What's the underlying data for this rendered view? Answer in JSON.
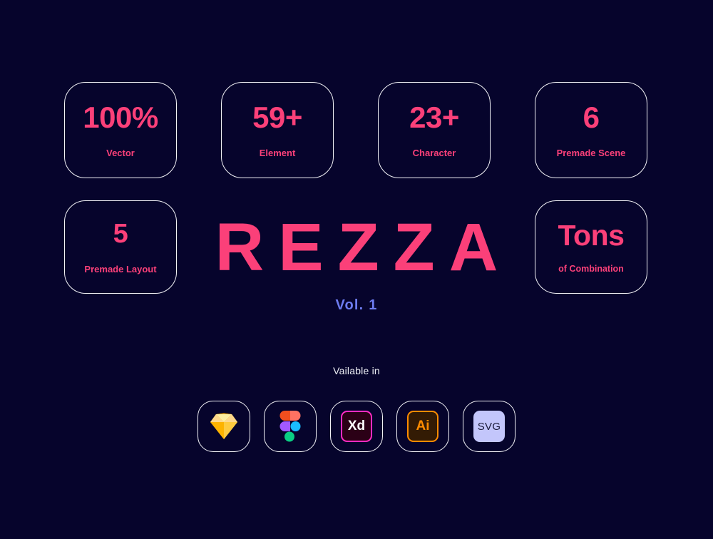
{
  "background_color": "#06042c",
  "accent_pink": "#fb4079",
  "accent_periwinkle": "#6d7cf0",
  "border_color": "#f2f2f7",
  "stats_row_one": [
    {
      "value": "100%",
      "label": "Vector"
    },
    {
      "value": "59+",
      "label": "Element"
    },
    {
      "value": "23+",
      "label": "Character"
    },
    {
      "value": "6",
      "label": "Premade Scene"
    }
  ],
  "stats_row_two": [
    {
      "value": "5",
      "label": "Premade Layout"
    },
    {
      "value": "Tons",
      "label": "of Combination"
    }
  ],
  "brand": {
    "title": "REZZA",
    "volume": "Vol. 1"
  },
  "availability": {
    "caption": "Vailable in",
    "apps": [
      {
        "name": "Sketch",
        "icon": "sketch-icon",
        "text": ""
      },
      {
        "name": "Figma",
        "icon": "figma-icon",
        "text": ""
      },
      {
        "name": "Adobe XD",
        "icon": "xd-icon",
        "text": "Xd"
      },
      {
        "name": "Adobe Illustrator",
        "icon": "ai-icon",
        "text": "Ai"
      },
      {
        "name": "SVG",
        "icon": "svg-icon",
        "text": "SVG"
      }
    ]
  }
}
